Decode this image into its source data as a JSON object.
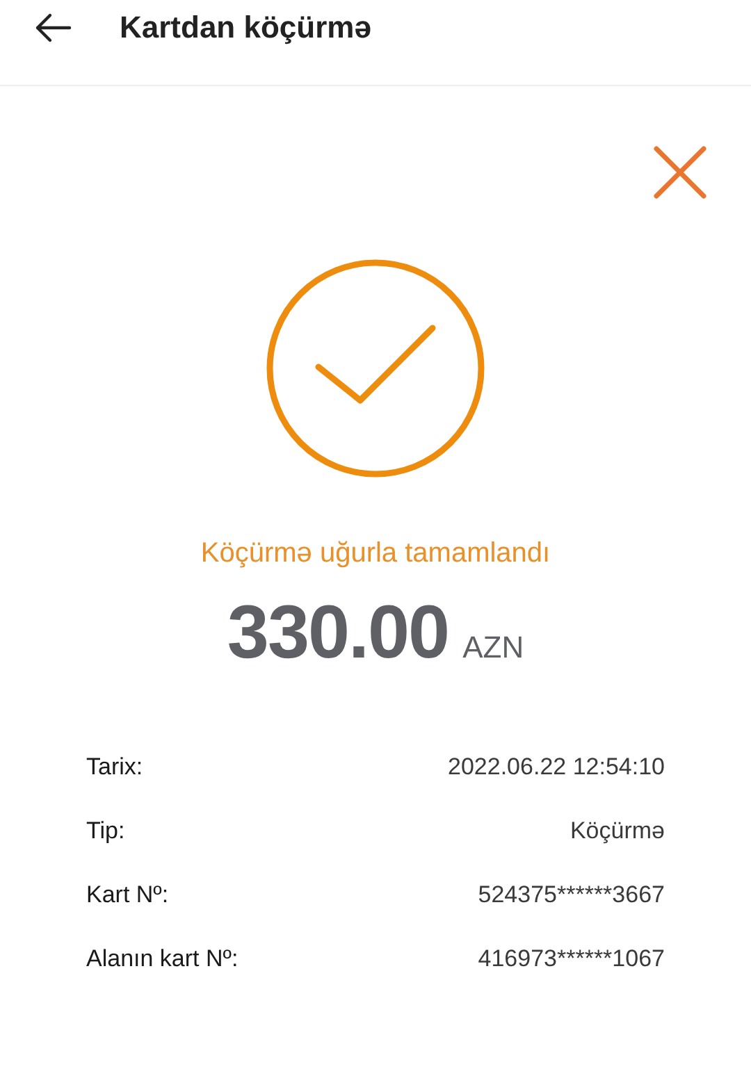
{
  "header": {
    "title": "Kartdan köçürmə"
  },
  "result": {
    "message": "Köçürmə uğurla tamamlandı",
    "amount": "330.00",
    "currency": "AZN"
  },
  "details": [
    {
      "label": "Tarix:",
      "value": "2022.06.22 12:54:10"
    },
    {
      "label": "Tip:",
      "value": "Köçürmə"
    },
    {
      "label": "Kart Nº:",
      "value": "524375******3667"
    },
    {
      "label": "Alanın kart Nº:",
      "value": "416973******1067"
    }
  ]
}
